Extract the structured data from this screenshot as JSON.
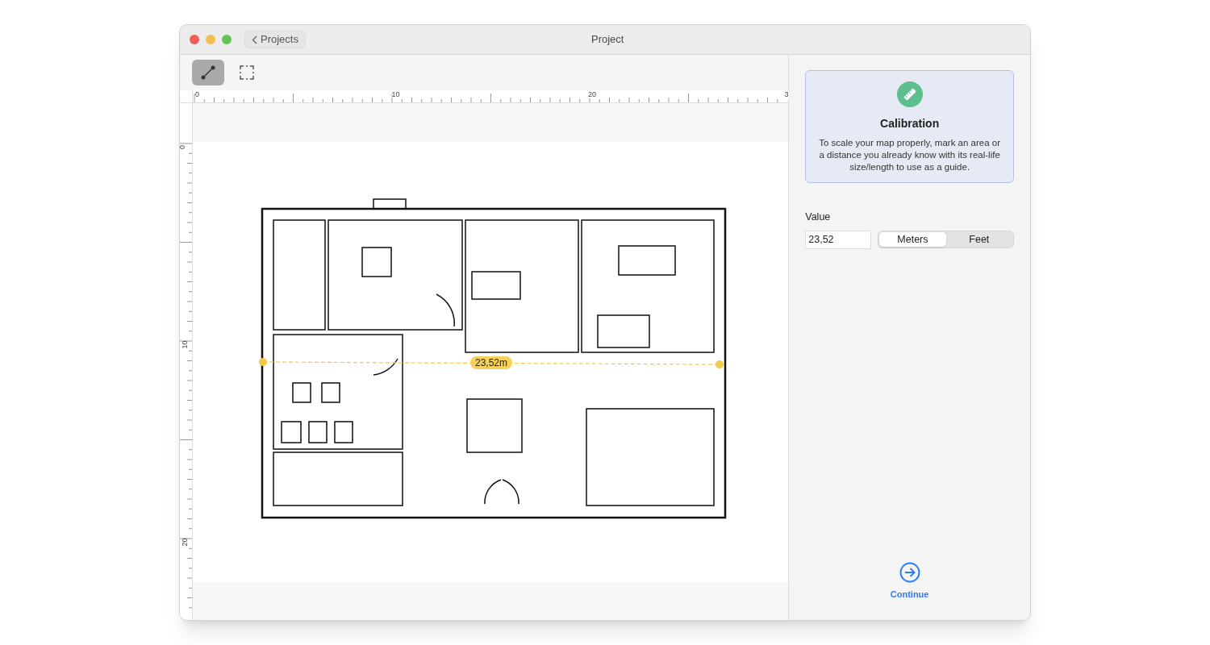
{
  "window": {
    "title": "Project",
    "back_button": "Projects"
  },
  "toolbar": {
    "tools": [
      {
        "kind": "line",
        "selected": true
      },
      {
        "kind": "area",
        "selected": false
      }
    ]
  },
  "rulers": {
    "horizontal": [
      "0",
      "10",
      "20",
      "3"
    ],
    "vertical": [
      "0",
      "10",
      "20"
    ]
  },
  "canvas": {
    "measurement": {
      "label": "23,52m"
    }
  },
  "calibration": {
    "title": "Calibration",
    "text": "To scale your map properly, mark an area or a distance you already know with its real-life size/length to use as a guide."
  },
  "value": {
    "label": "Value",
    "value": "23,52",
    "units": [
      {
        "label": "Meters",
        "selected": true
      },
      {
        "label": "Feet",
        "selected": false
      }
    ]
  },
  "continue_button": "Continue"
}
